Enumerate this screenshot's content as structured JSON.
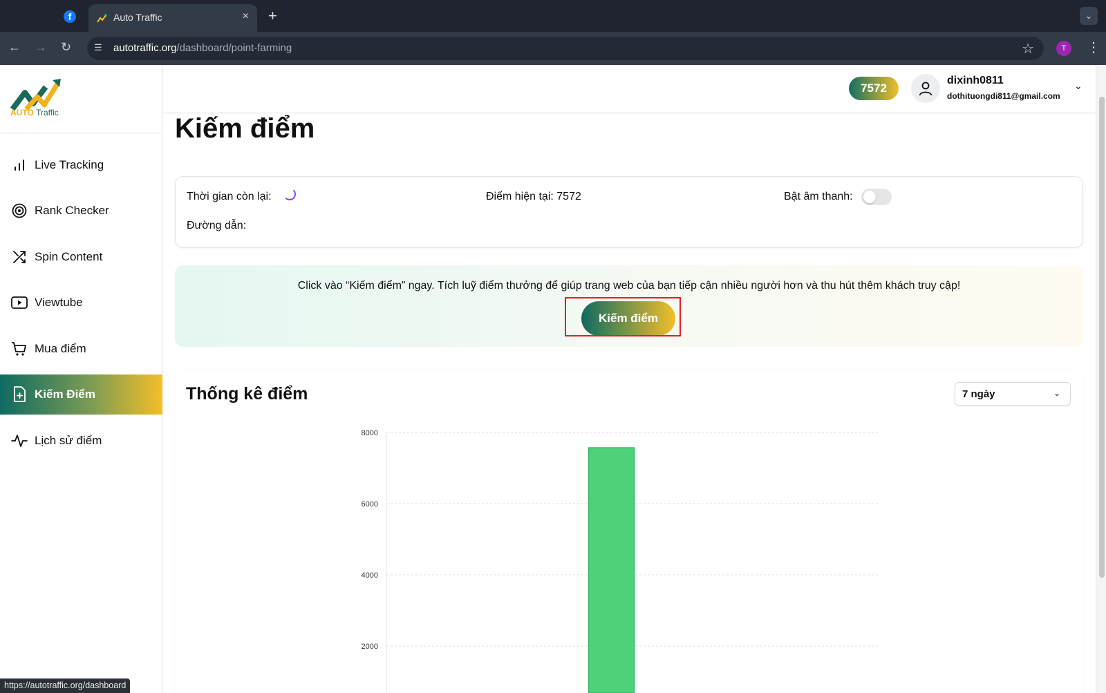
{
  "browser": {
    "tab_title": "Auto Traffic",
    "tab_close": "×",
    "new_tab": "+",
    "url_host": "autotraffic.org",
    "url_path": "/dashboard/point-farming",
    "profile_initial": "T",
    "status_url": "https://autotraffic.org/dashboard"
  },
  "brand": {
    "logo_word1": "AUTO",
    "logo_word2": "Traffic",
    "accent": "#0f6a62",
    "accent2": "#f2bf2a"
  },
  "sidebar": {
    "items": [
      {
        "label": "Live Tracking",
        "icon": "bar-chart-icon"
      },
      {
        "label": "Rank Checker",
        "icon": "target-icon"
      },
      {
        "label": "Spin Content",
        "icon": "shuffle-icon"
      },
      {
        "label": "Viewtube",
        "icon": "youtube-icon"
      },
      {
        "label": "Mua điểm",
        "icon": "cart-icon"
      },
      {
        "label": "Kiếm Điểm",
        "icon": "file-plus-icon",
        "active": true
      },
      {
        "label": "Lịch sử điểm",
        "icon": "activity-icon"
      }
    ]
  },
  "header": {
    "points": "7572",
    "username": "dixinh0811",
    "email": "dothituongdi811@gmail.com"
  },
  "main": {
    "title": "Kiếm điểm",
    "time_left_label": "Thời gian còn lại:",
    "current_points_label": "Điểm hiện tại: 7572",
    "sound_label": "Bật âm thanh:",
    "sound_on": false,
    "path_label": "Đường dẫn:",
    "promo_text": "Click vào “Kiếm điểm” ngay. Tích luỹ điểm thưởng để giúp trang web của bạn tiếp cận nhiều người hơn và thu hút thêm khách truy cập!",
    "earn_button": "Kiếm điểm"
  },
  "stats": {
    "title": "Thống kê điểm",
    "range": "7 ngày"
  },
  "chart_data": {
    "type": "bar",
    "bar_values": [
      7572
    ],
    "bar_position_fraction": 0.456,
    "yticks": [
      "8000",
      "6000",
      "4000",
      "2000"
    ],
    "ytick_values": [
      8000,
      6000,
      4000,
      2000
    ],
    "ylim": [
      0,
      8000
    ],
    "grid": true,
    "bar_color": "#4fd17a"
  }
}
